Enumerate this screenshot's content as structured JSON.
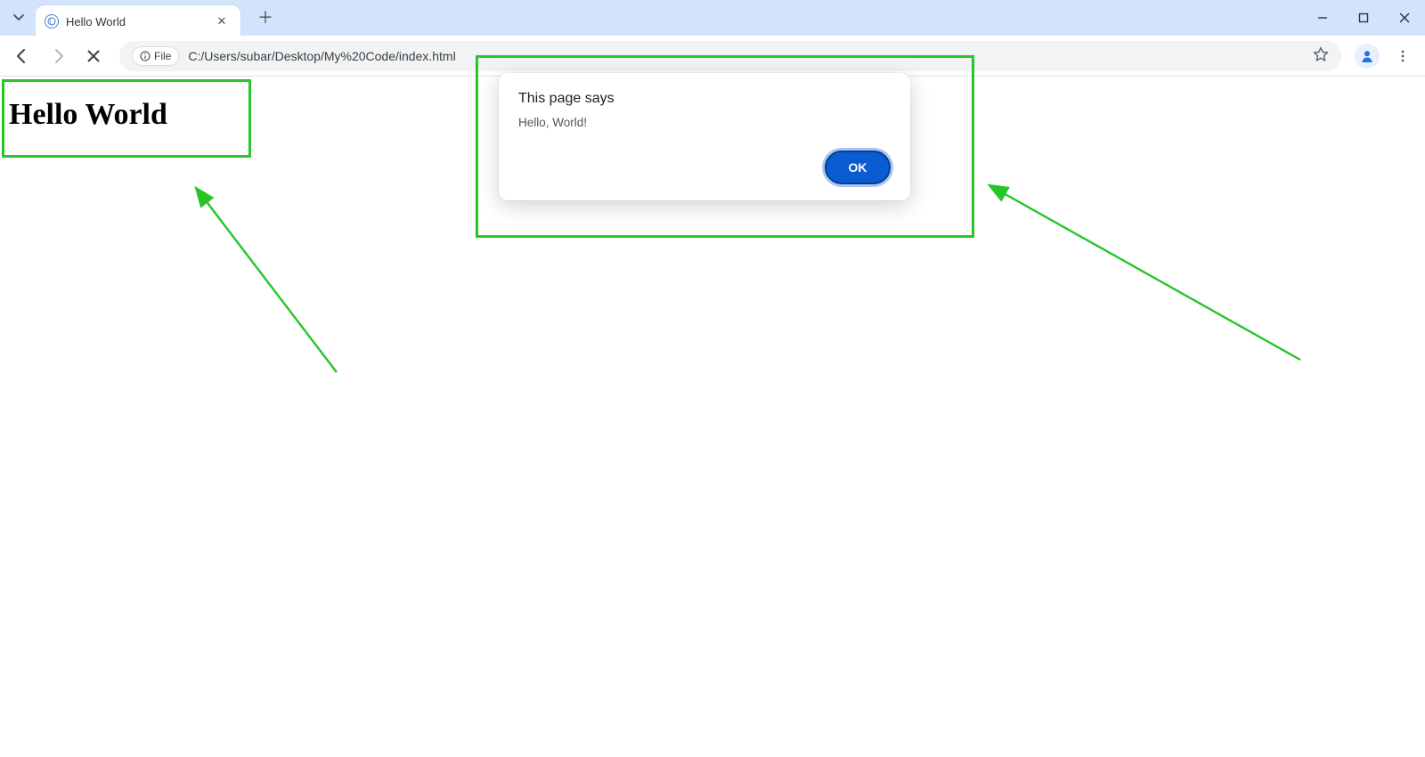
{
  "browser": {
    "tab": {
      "title": "Hello World"
    },
    "omnibox": {
      "scheme_label": "File",
      "url": "C:/Users/subar/Desktop/My%20Code/index.html"
    }
  },
  "page": {
    "heading": "Hello World"
  },
  "dialog": {
    "title": "This page says",
    "message": "Hello, World!",
    "ok_label": "OK"
  },
  "annotation": {
    "highlight_color": "#28c528"
  }
}
